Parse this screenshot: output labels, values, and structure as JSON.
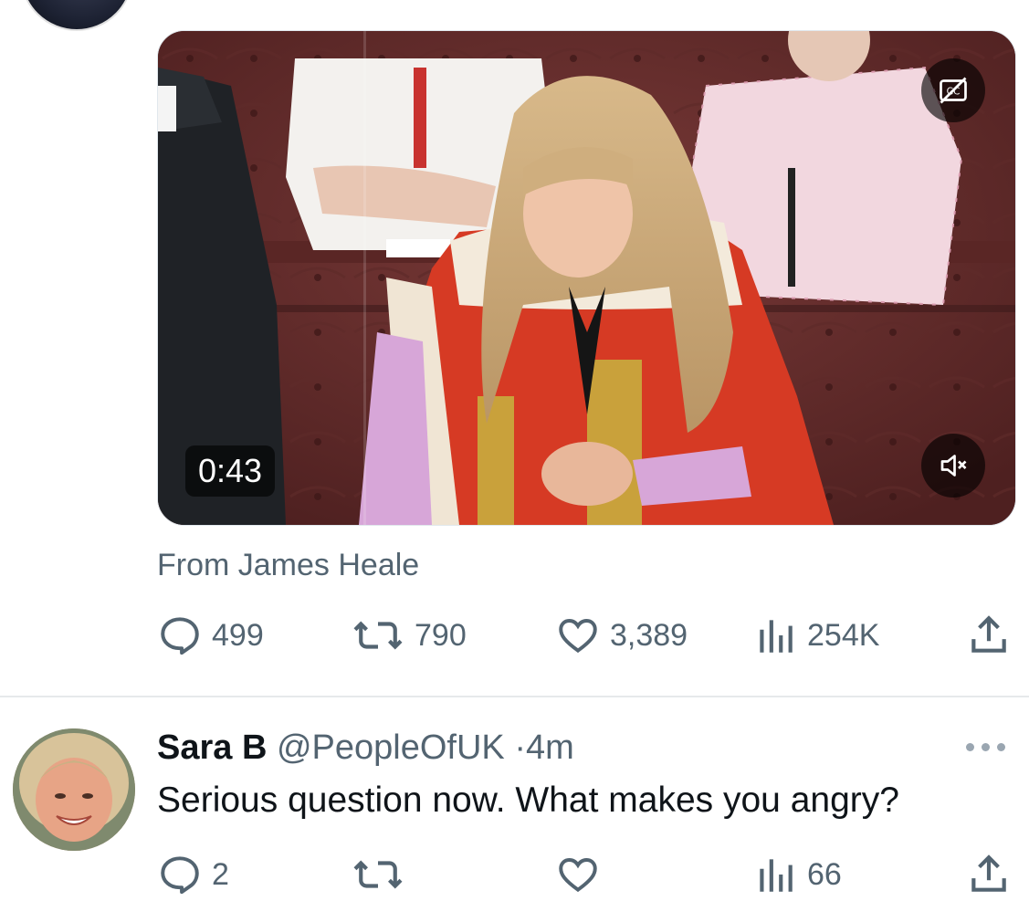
{
  "colors": {
    "text_primary": "#0f1419",
    "text_secondary": "#536471",
    "divider": "#e6e9eb",
    "overlay": "rgba(0,0,0,0.62)"
  },
  "tweet": {
    "media": {
      "duration": "0:43",
      "captions_icon": "captions-off-icon",
      "mute_icon": "volume-muted-icon"
    },
    "source_text": "From James Heale",
    "actions": {
      "replies": "499",
      "reposts": "790",
      "likes": "3,389",
      "views": "254K"
    }
  },
  "reply": {
    "name": "Sara B",
    "handle": "@PeopleOfUK",
    "separator": "·",
    "time": "4m",
    "text": "Serious question now. What makes you angry?",
    "actions": {
      "replies": "2",
      "reposts": "",
      "likes": "",
      "views": "66"
    }
  }
}
